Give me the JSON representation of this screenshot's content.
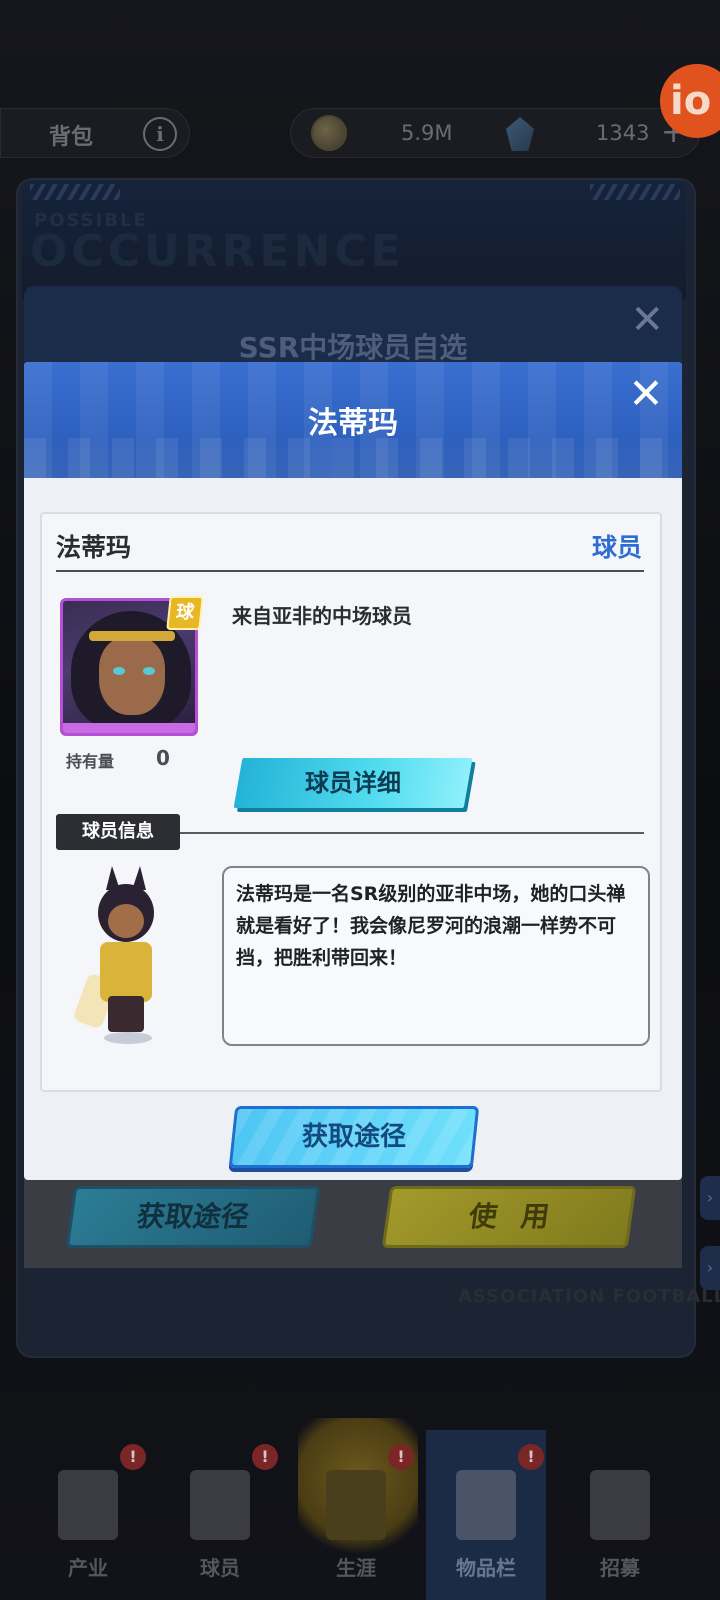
{
  "topbar": {
    "bag_label": "背包",
    "info_icon": "info-icon",
    "coins": "5.9M",
    "gems": "1343",
    "plus": "+",
    "avatar_text": "io"
  },
  "background": {
    "occurrence_small": "POSSIBLE",
    "occurrence_big": "OCCURRENCE",
    "mid_dialog_title": "SSR中场球员自选",
    "acquire_label": "获取途径",
    "use_label": "使用",
    "assoc_text": "ASSOCIATION FOOTBALL"
  },
  "dialog": {
    "title": "法蒂玛",
    "close_icon": "close-icon",
    "card": {
      "name": "法蒂玛",
      "type": "球员",
      "badge": "球",
      "hold_label": "持有量",
      "hold_value": "0",
      "origin": "来自亚非的中场球员",
      "detail_button": "球员详细",
      "info_tag": "球员信息",
      "description": "法蒂玛是一名SR级别的亚非中场，她的口头禅就是看好了！我会像尼罗河的浪潮一样势不可挡，把胜利带回来！"
    },
    "acquire_button": "获取途径"
  },
  "nav": {
    "items": [
      {
        "label": "产业",
        "icon": "industry-building-icon",
        "alert": "!"
      },
      {
        "label": "球员",
        "icon": "players-group-icon",
        "alert": "!"
      },
      {
        "label": "生涯",
        "icon": "career-trophy-icon",
        "alert": "!"
      },
      {
        "label": "物品栏",
        "icon": "inventory-suitcase-icon",
        "alert": "!"
      },
      {
        "label": "招募",
        "icon": "recruit-stadium-icon",
        "alert": ""
      }
    ]
  },
  "colors": {
    "dialog_header": "#2e61c0",
    "type_label": "#2d6cd2",
    "detail_button": "#52dcef",
    "acquire_button": "#4fc5f4",
    "rarity_border": "#b44fd6",
    "badge": "#e8b824"
  }
}
